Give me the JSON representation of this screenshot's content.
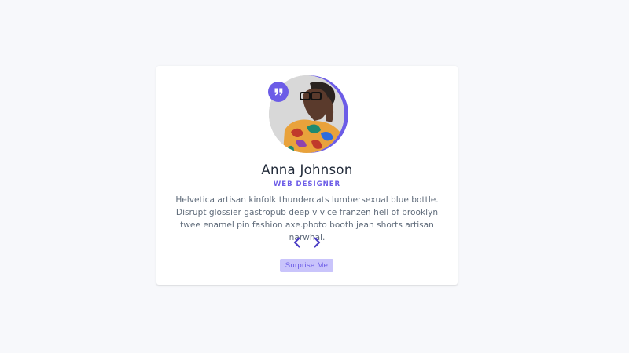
{
  "review": {
    "author": "Anna Johnson",
    "job": "Web Designer",
    "text": "Helvetica artisan kinfolk thundercats lumbersexual blue bottle. Disrupt glossier gastropub deep v vice franzen hell of brooklyn twee enamel pin fashion axe.photo booth jean shorts artisan narwhal."
  },
  "icons": {
    "quote": "quote-right-icon",
    "prev": "chevron-left-icon",
    "next": "chevron-right-icon"
  },
  "controls": {
    "random_label": "Surprise Me"
  },
  "colors": {
    "accent": "#6c5ce7",
    "accent_light": "#c9c4fb",
    "background": "#f7f8fb",
    "card": "#ffffff",
    "title": "#222b3a",
    "body_text": "#5f6b7a"
  }
}
